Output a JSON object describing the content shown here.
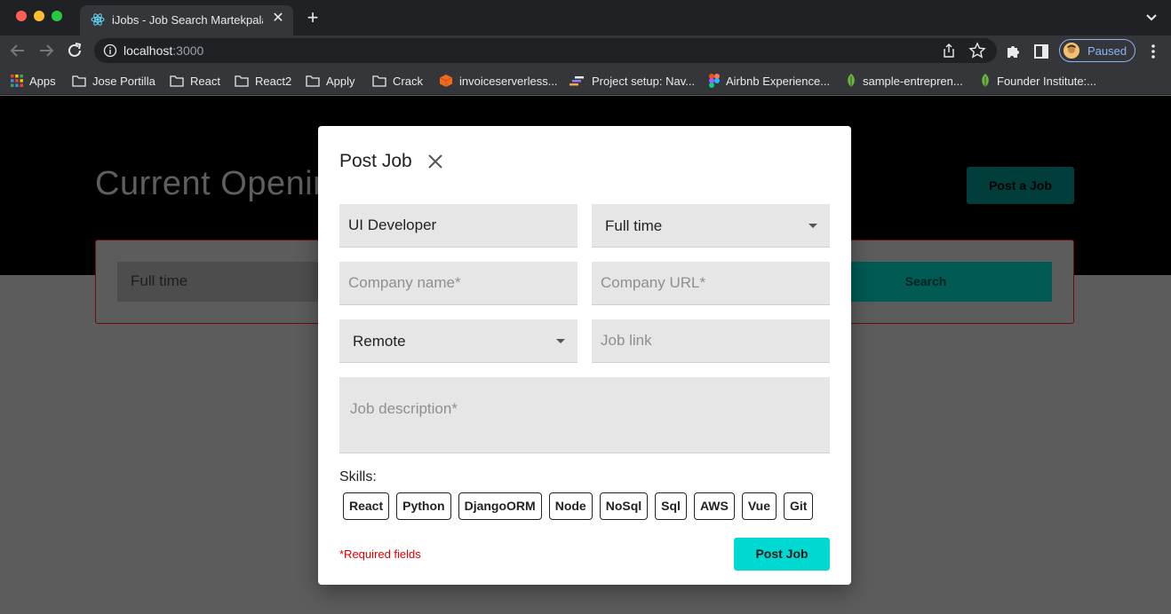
{
  "browser": {
    "tab_title": "iJobs - Job Search Martekpalace",
    "url_host": "localhost",
    "url_port": ":3000",
    "profile_label": "Paused",
    "bookmarks": [
      {
        "label": "Apps",
        "icon": "apps-grid-icon"
      },
      {
        "label": "Jose Portilla",
        "icon": "folder-icon"
      },
      {
        "label": "React",
        "icon": "folder-icon"
      },
      {
        "label": "React2",
        "icon": "folder-icon"
      },
      {
        "label": "Apply",
        "icon": "folder-icon"
      },
      {
        "label": "Crack",
        "icon": "folder-icon"
      },
      {
        "label": "invoiceserverless...",
        "icon": "aws-cube-icon"
      },
      {
        "label": "Project setup: Nav...",
        "icon": "setup-icon"
      },
      {
        "label": "Airbnb Experience...",
        "icon": "figma-icon"
      },
      {
        "label": "sample-entrepren...",
        "icon": "leaf-icon"
      },
      {
        "label": "Founder Institute:...",
        "icon": "leaf-icon"
      }
    ]
  },
  "page": {
    "heading": "Current Openings",
    "post_job_button": "Post a Job",
    "filter_value": "Full time",
    "search_button": "Search"
  },
  "modal": {
    "title": "Post Job",
    "job_title_value": "UI Developer",
    "job_type_value": "Full time",
    "company_name_placeholder": "Company name*",
    "company_url_placeholder": "Company URL*",
    "location_value": "Remote",
    "job_link_placeholder": "Job link",
    "description_placeholder": "Job description*",
    "skills_label": "Skills:",
    "skills": [
      "React",
      "Python",
      "DjangoORM",
      "Node",
      "NoSql",
      "Sql",
      "AWS",
      "Vue",
      "Git"
    ],
    "required_note": "*Required fields",
    "submit_label": "Post Job"
  },
  "colors": {
    "accent": "#00d8d2",
    "required": "#e00000"
  }
}
